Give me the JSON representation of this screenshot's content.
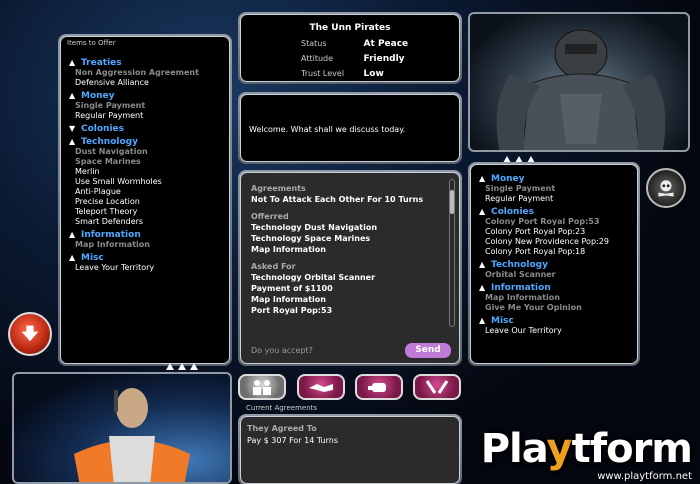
{
  "offer_panel": {
    "title": "Items to Offer",
    "items": [
      {
        "kind": "cat",
        "arrow": "▲",
        "text": "Treaties"
      },
      {
        "kind": "sub",
        "text": "Non Aggression Agreement"
      },
      {
        "kind": "val",
        "text": "Defensive Alliance"
      },
      {
        "kind": "cat",
        "arrow": "▲",
        "text": "Money"
      },
      {
        "kind": "sub",
        "text": "Single Payment"
      },
      {
        "kind": "val",
        "text": "Regular Payment"
      },
      {
        "kind": "cat",
        "arrow": "▼",
        "text": "Colonies"
      },
      {
        "kind": "cat",
        "arrow": "▲",
        "text": "Technology"
      },
      {
        "kind": "sub",
        "text": "Dust Navigation"
      },
      {
        "kind": "sub",
        "text": "Space Marines"
      },
      {
        "kind": "val",
        "text": "Merlin"
      },
      {
        "kind": "val",
        "text": "Use Small Wormholes"
      },
      {
        "kind": "val",
        "text": "Anti-Plague"
      },
      {
        "kind": "val",
        "text": "Precise Location"
      },
      {
        "kind": "val",
        "text": "Teleport Theory"
      },
      {
        "kind": "val",
        "text": "Smart Defenders"
      },
      {
        "kind": "cat",
        "arrow": "▲",
        "text": "Information"
      },
      {
        "kind": "sub",
        "text": "Map Information"
      },
      {
        "kind": "cat",
        "arrow": "▲",
        "text": "Misc"
      },
      {
        "kind": "val",
        "text": "Leave Your Territory"
      }
    ]
  },
  "faction": {
    "name": "The Unn Pirates",
    "status_label": "Status",
    "status_value": "At Peace",
    "attitude_label": "Attitude",
    "attitude_value": "Friendly",
    "trust_label": "Trust Level",
    "trust_value": "Low"
  },
  "dialog": {
    "text": "Welcome. What shall we discuss today."
  },
  "deal": {
    "agreements_header": "Agreements",
    "agreements": [
      "Not To Attack Each Other For 10 Turns"
    ],
    "offered_header": "Offerred",
    "offered": [
      "Technology Dust Navigation",
      "Technology Space Marines",
      "Map Information"
    ],
    "asked_header": "Asked For",
    "asked": [
      "Technology Orbital Scanner",
      "Payment of $1100",
      "Map Information",
      "Port Royal Pop:53"
    ],
    "prompt": "Do you accept?",
    "send_label": "Send"
  },
  "request_panel": {
    "items": [
      {
        "kind": "cat",
        "arrow": "▲",
        "text": "Money"
      },
      {
        "kind": "sub",
        "text": "Single Payment"
      },
      {
        "kind": "val",
        "text": "Regular Payment"
      },
      {
        "kind": "cat",
        "arrow": "▲",
        "text": "Colonies"
      },
      {
        "kind": "sub",
        "text": "Colony Port Royal  Pop:53"
      },
      {
        "kind": "val",
        "text": "Colony Port Royal  Pop:23"
      },
      {
        "kind": "val",
        "text": "Colony New Providence  Pop:29"
      },
      {
        "kind": "val",
        "text": "Colony Port Royal  Pop:18"
      },
      {
        "kind": "cat",
        "arrow": "▲",
        "text": "Technology"
      },
      {
        "kind": "sub",
        "text": "Orbital Scanner"
      },
      {
        "kind": "cat",
        "arrow": "▲",
        "text": "Information"
      },
      {
        "kind": "sub",
        "text": "Map Information"
      },
      {
        "kind": "sub",
        "text": "Give Me Your Opinion"
      },
      {
        "kind": "cat",
        "arrow": "▲",
        "text": "Misc"
      },
      {
        "kind": "val",
        "text": "Leave Our Territory"
      }
    ]
  },
  "current_agreements": {
    "title": "Current Agreements",
    "header": "They Agreed To",
    "items": [
      "Pay $ 307 For 14 Turns"
    ]
  },
  "watermark": {
    "play": "Pla",
    "y": "y",
    "tform": "tform",
    "url": "www.playtform.net"
  },
  "colors": {
    "category": "#4fa8ff",
    "subitem": "#8a8a8a",
    "send": "#c07ad8"
  }
}
